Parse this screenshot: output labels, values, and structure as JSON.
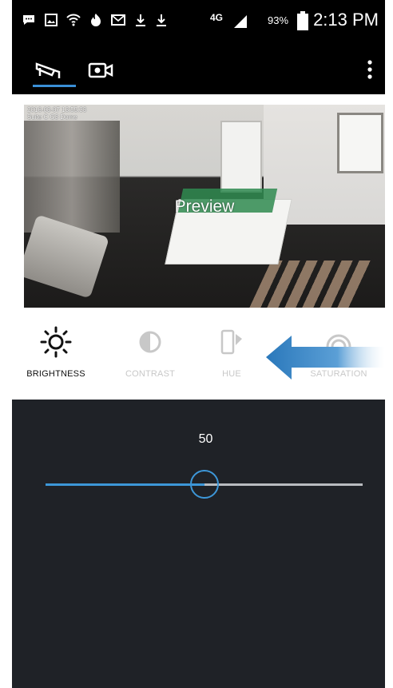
{
  "status_bar": {
    "icons": [
      "chat-icon",
      "gallery-icon",
      "wifi-icon",
      "flame-icon",
      "mail-icon",
      "download-icon",
      "download-icon",
      "lte-icon",
      "signal-icon",
      "battery-icon"
    ],
    "network": "4G",
    "battery": "93%",
    "time": "2:13 PM"
  },
  "app_bar": {
    "tabs": [
      {
        "icon": "cctv-camera-icon",
        "active": true
      },
      {
        "icon": "video-camera-icon",
        "active": false
      }
    ],
    "menu_icon": "overflow-menu-icon"
  },
  "preview": {
    "timestamp": "2016-03-07 13:55:33",
    "camera_name": "Suite C G3 Dome",
    "label": "Preview"
  },
  "adjustments": [
    {
      "label": "BRIGHTNESS",
      "icon": "sun-icon",
      "active": true
    },
    {
      "label": "CONTRAST",
      "icon": "contrast-icon",
      "active": false
    },
    {
      "label": "HUE",
      "icon": "hue-icon",
      "active": false
    },
    {
      "label": "SATURATION",
      "icon": "saturation-icon",
      "active": false
    }
  ],
  "slider": {
    "value": "50",
    "level": 0.5
  },
  "colors": {
    "accent": "#3d97d8",
    "panel": "#1f2227",
    "arrow": "#2f7fc0"
  }
}
